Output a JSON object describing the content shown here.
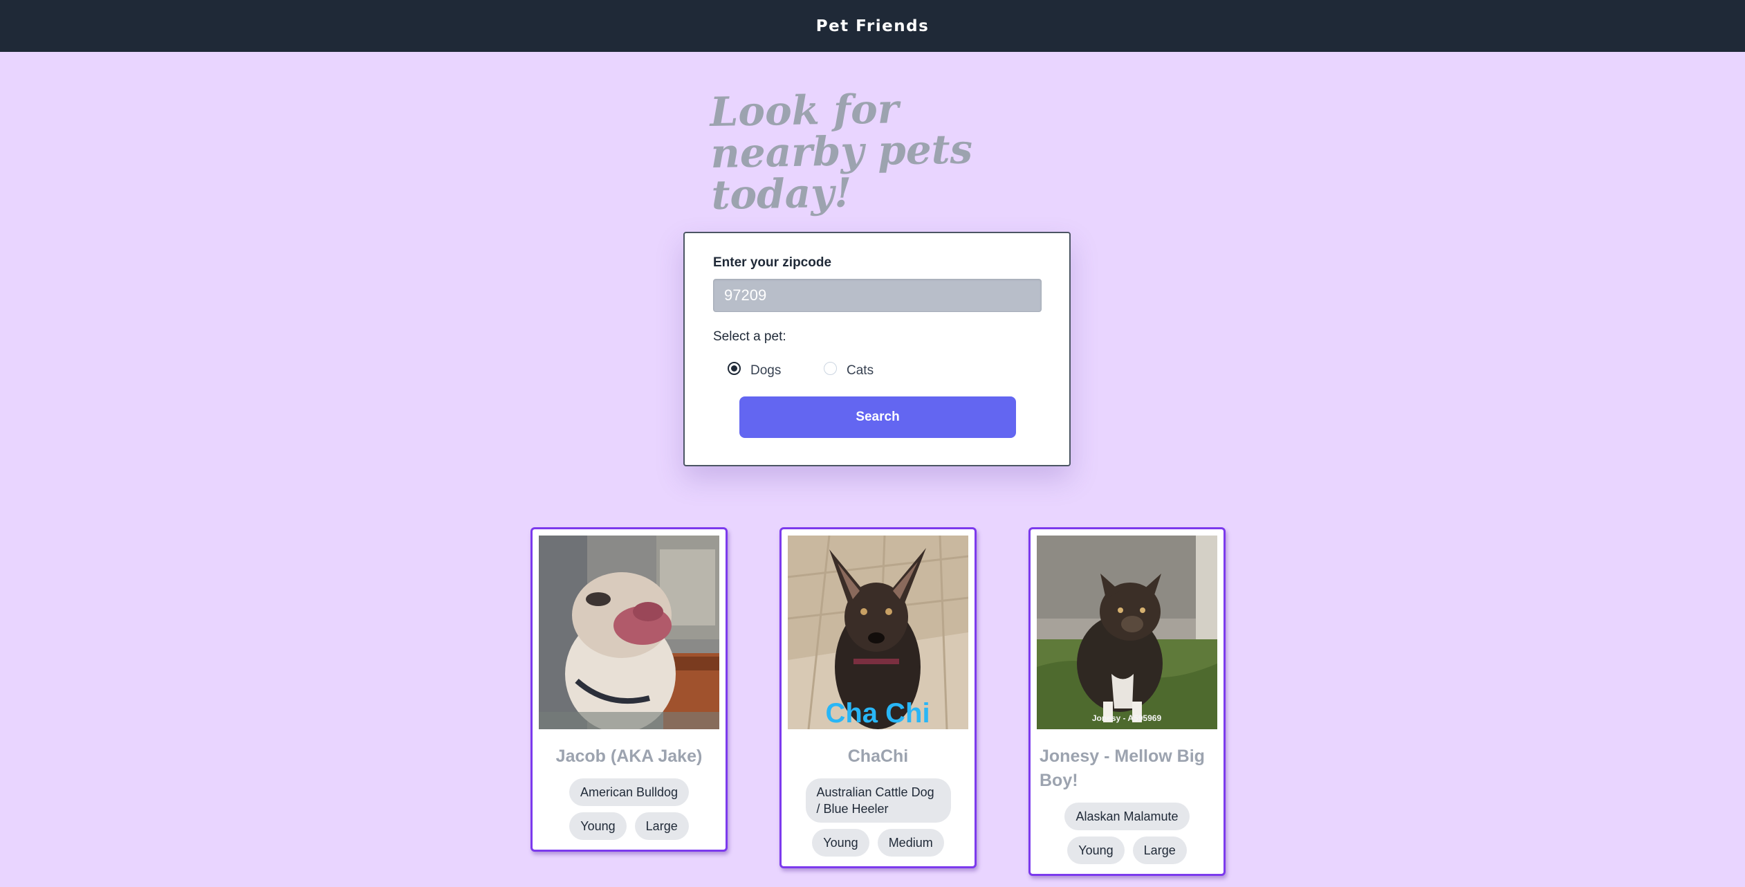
{
  "header": {
    "brand": "Pet Friends"
  },
  "hero": {
    "headline": "Look for nearby pets today!"
  },
  "search": {
    "zip_label": "Enter your zipcode",
    "zip_value": "97209",
    "pet_label": "Select a pet:",
    "options": [
      {
        "label": "Dogs",
        "selected": true
      },
      {
        "label": "Cats",
        "selected": false
      }
    ],
    "button_label": "Search"
  },
  "results": [
    {
      "name": "Jacob (AKA Jake)",
      "tags": [
        "American Bulldog",
        "Young",
        "Large"
      ]
    },
    {
      "name": "ChaChi",
      "photo_caption": "Cha Chi",
      "tags": [
        "Australian Cattle Dog / Blue Heeler",
        "Young",
        "Medium"
      ]
    },
    {
      "name": "Jonesy - Mellow Big Boy!",
      "photo_caption": "Jonesy - A595969",
      "tags": [
        "Alaskan Malamute",
        "Young",
        "Large"
      ]
    }
  ],
  "colors": {
    "page_bg": "#e9d5ff",
    "header_bg": "#1f2937",
    "button": "#6366f1",
    "card_border": "#7c3aed",
    "muted_text": "#9ca3af"
  }
}
